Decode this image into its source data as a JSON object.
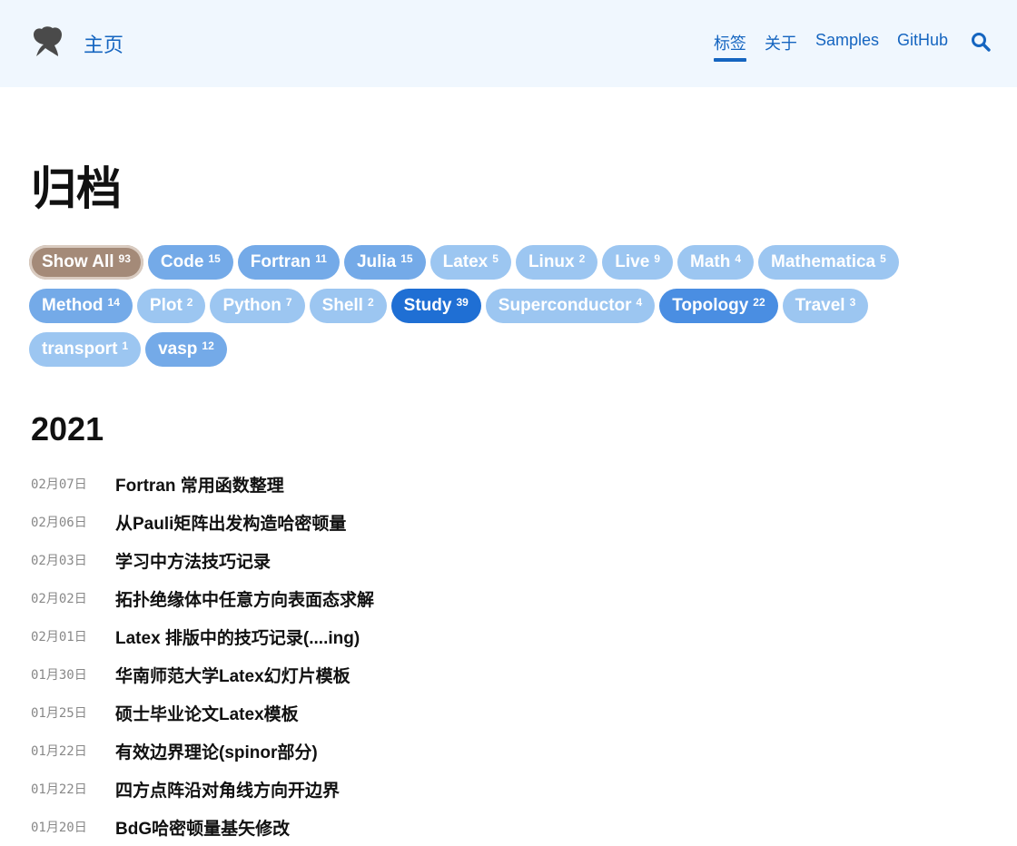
{
  "header": {
    "home_label": "主页",
    "nav": [
      {
        "label": "标签",
        "active": true
      },
      {
        "label": "关于",
        "active": false
      },
      {
        "label": "Samples",
        "active": false
      },
      {
        "label": "GitHub",
        "active": false
      }
    ],
    "search_icon": "search-icon",
    "accent_color": "#1565c0"
  },
  "page_title": "归档",
  "tags": [
    {
      "name": "Show All",
      "count": "93",
      "color": "#a48a78"
    },
    {
      "name": "Code",
      "count": "15",
      "color": "#74aae8"
    },
    {
      "name": "Fortran",
      "count": "11",
      "color": "#74aae8"
    },
    {
      "name": "Julia",
      "count": "15",
      "color": "#74aae8"
    },
    {
      "name": "Latex",
      "count": "5",
      "color": "#9cc6f1"
    },
    {
      "name": "Linux",
      "count": "2",
      "color": "#9cc6f1"
    },
    {
      "name": "Live",
      "count": "9",
      "color": "#9cc6f1"
    },
    {
      "name": "Math",
      "count": "4",
      "color": "#9cc6f1"
    },
    {
      "name": "Mathematica",
      "count": "5",
      "color": "#9cc6f1"
    },
    {
      "name": "Method",
      "count": "14",
      "color": "#74aae8"
    },
    {
      "name": "Plot",
      "count": "2",
      "color": "#9cc6f1"
    },
    {
      "name": "Python",
      "count": "7",
      "color": "#9cc6f1"
    },
    {
      "name": "Shell",
      "count": "2",
      "color": "#9cc6f1"
    },
    {
      "name": "Study",
      "count": "39",
      "color": "#1f6fd4"
    },
    {
      "name": "Superconductor",
      "count": "4",
      "color": "#9cc6f1"
    },
    {
      "name": "Topology",
      "count": "22",
      "color": "#4a8ee2"
    },
    {
      "name": "Travel",
      "count": "3",
      "color": "#9cc6f1"
    },
    {
      "name": "transport",
      "count": "1",
      "color": "#9cc6f1"
    },
    {
      "name": "vasp",
      "count": "12",
      "color": "#74aae8"
    }
  ],
  "year": "2021",
  "posts": [
    {
      "date": "02月07日",
      "title": "Fortran 常用函数整理"
    },
    {
      "date": "02月06日",
      "title": "从Pauli矩阵出发构造哈密顿量"
    },
    {
      "date": "02月03日",
      "title": "学习中方法技巧记录"
    },
    {
      "date": "02月02日",
      "title": "拓扑绝缘体中任意方向表面态求解"
    },
    {
      "date": "02月01日",
      "title": "Latex 排版中的技巧记录(....ing)"
    },
    {
      "date": "01月30日",
      "title": "华南师范大学Latex幻灯片模板"
    },
    {
      "date": "01月25日",
      "title": "硕士毕业论文Latex模板"
    },
    {
      "date": "01月22日",
      "title": "有效边界理论(spinor部分)"
    },
    {
      "date": "01月22日",
      "title": "四方点阵沿对角线方向开边界"
    },
    {
      "date": "01月20日",
      "title": "BdG哈密顿量基矢修改"
    }
  ]
}
